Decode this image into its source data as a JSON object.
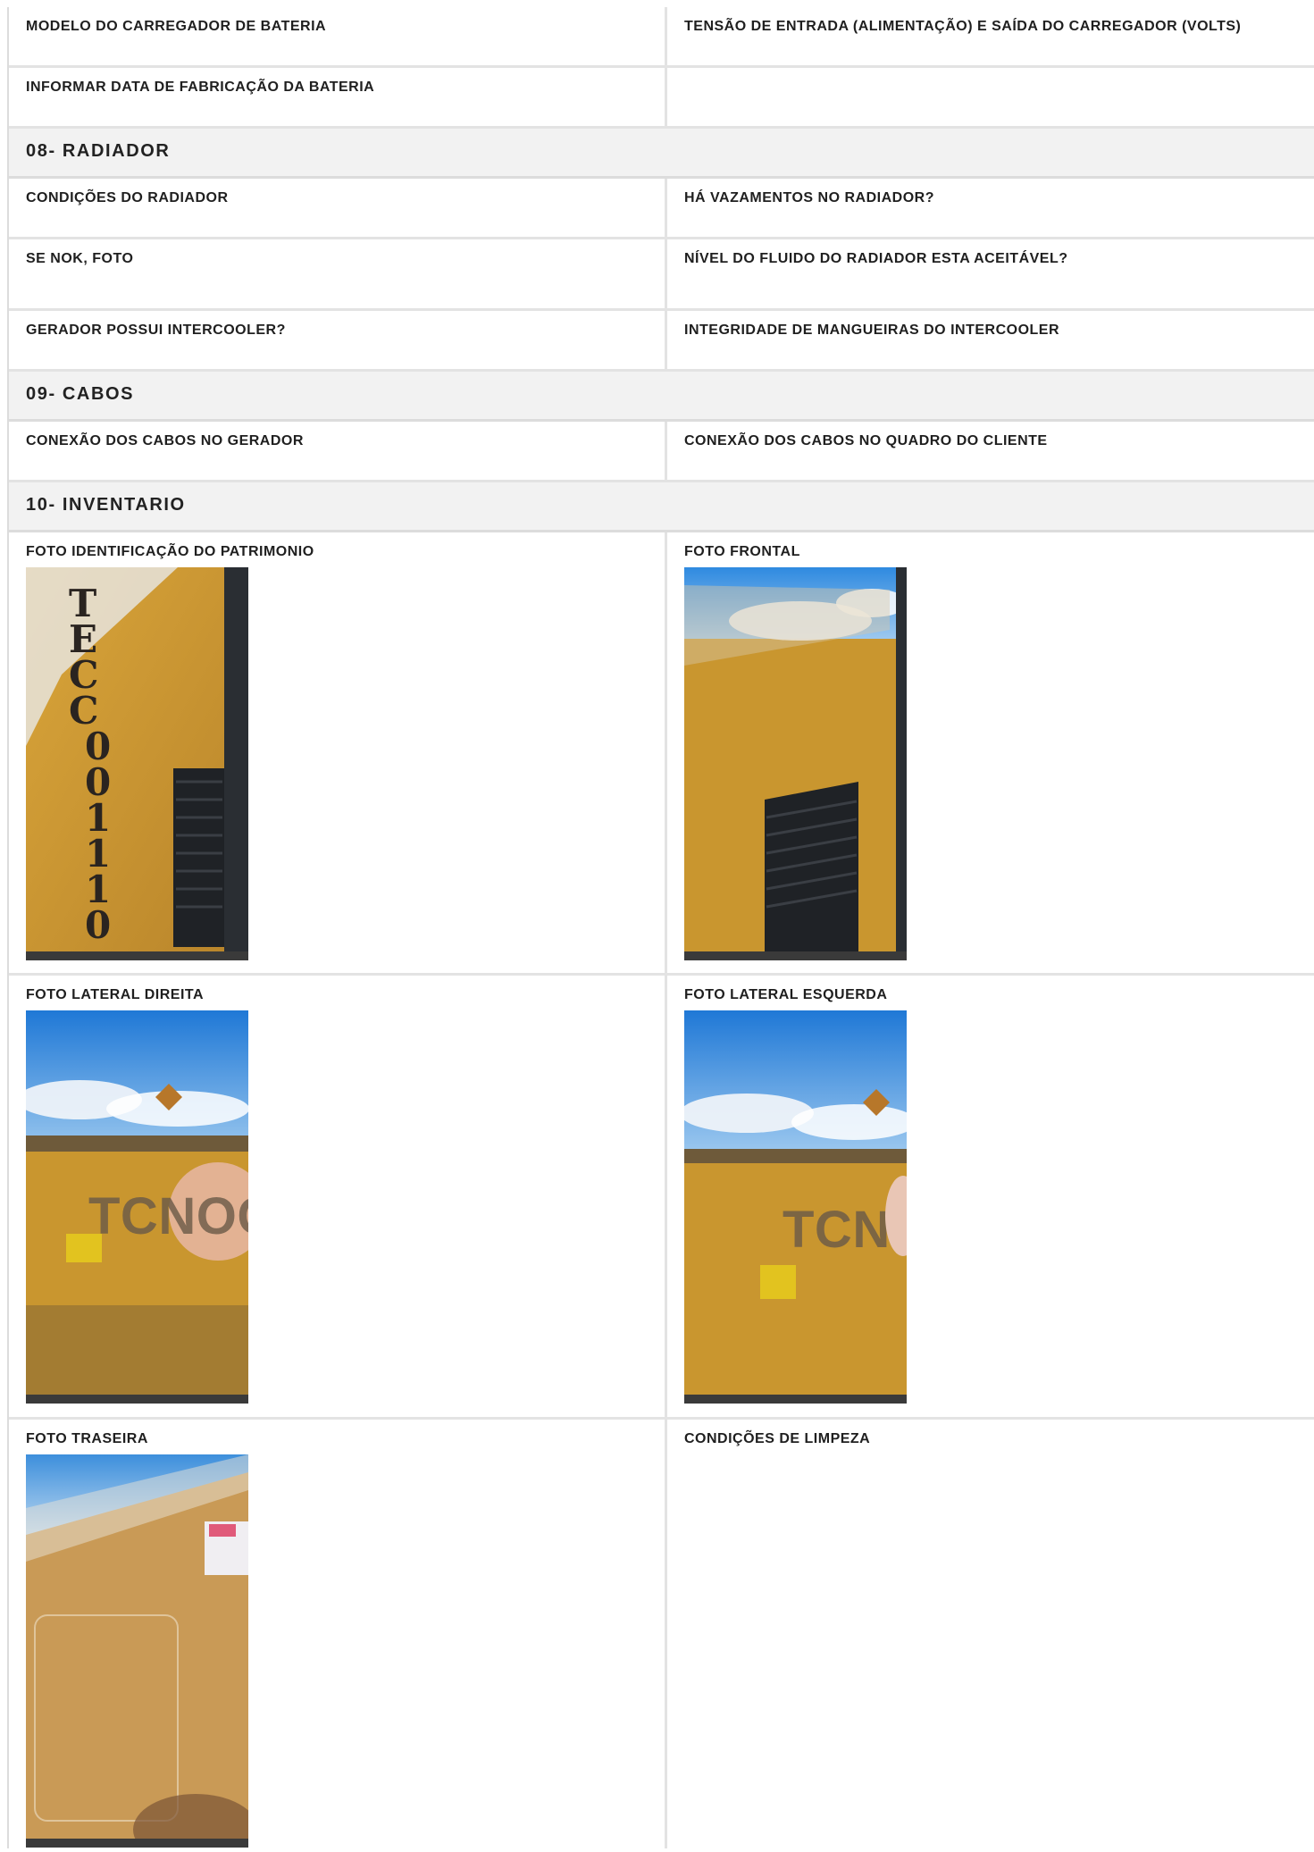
{
  "rows_top": {
    "battery_charger_model": "MODELO DO CARREGADOR DE BATERIA",
    "charger_voltage": "TENSÃO DE ENTRADA (ALIMENTAÇÃO) E SAÍDA DO CARREGADOR (VOLTS)",
    "battery_manufacture_date": "INFORMAR DATA DE FABRICAÇÃO DA BATERIA"
  },
  "section_08": {
    "title": "08- RADIADOR",
    "radiator_conditions": "CONDIÇÕES DO RADIADOR",
    "radiator_leaks": "HÁ VAZAMENTOS NO RADIADOR?",
    "if_nok_photo": "SE NOK, FOTO",
    "fluid_level": "NÍVEL DO FLUIDO DO RADIADOR ESTA ACEITÁVEL?",
    "has_intercooler": "GERADOR POSSUI INTERCOOLER?",
    "intercooler_hoses": "INTEGRIDADE DE MANGUEIRAS DO INTERCOOLER"
  },
  "section_09": {
    "title": "09- CABOS",
    "cables_generator": "CONEXÃO DOS CABOS NO GERADOR",
    "cables_client_panel": "CONEXÃO DOS CABOS NO QUADRO DO CLIENTE"
  },
  "section_10": {
    "title": "10- INVENTARIO",
    "photo_asset_id": "FOTO IDENTIFICAÇÃO DO PATRIMONIO",
    "photo_front": "FOTO FRONTAL",
    "photo_right": "FOTO LATERAL DIREITA",
    "photo_left": "FOTO LATERAL ESQUERDA",
    "photo_rear": "FOTO TRASEIRA",
    "cleaning_conditions": "CONDIÇÕES DE LIMPEZA"
  },
  "photo_text": {
    "asset_id_letters": [
      "T",
      "E",
      "C",
      "C",
      "0",
      "0",
      "1",
      "1",
      "1",
      "0"
    ],
    "brand_right": "tcnoge",
    "brand_left": "tcno"
  },
  "colors": {
    "generator_yellow": "#c9962f",
    "sky_blue": "#2f8ae0",
    "section_bg": "#f2f2f2",
    "border": "#e3e3e3"
  }
}
